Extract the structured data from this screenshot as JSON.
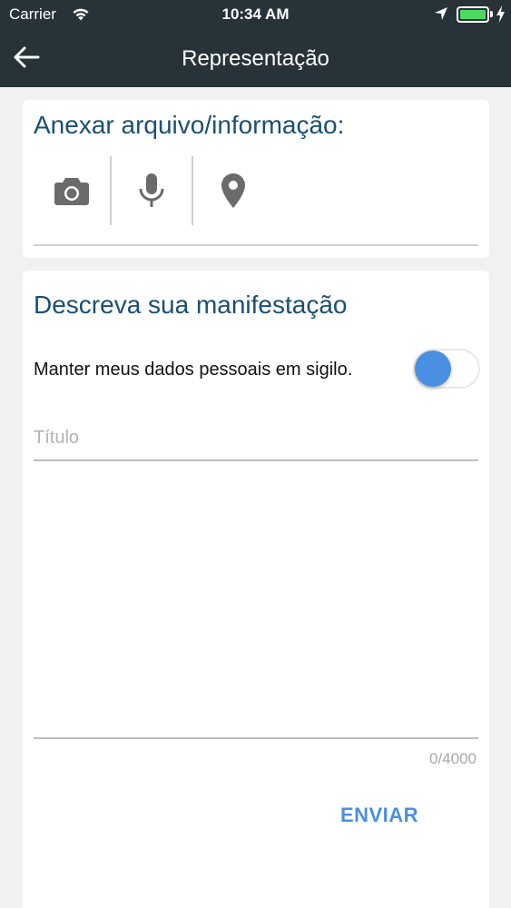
{
  "status_bar": {
    "carrier": "Carrier",
    "time": "10:34 AM",
    "battery_level": 1.0,
    "icons": [
      "wifi-icon",
      "location-arrow-icon",
      "battery-icon",
      "charging-bolt-icon"
    ]
  },
  "app_bar": {
    "title": "Representação",
    "back_icon": "arrow-left-icon"
  },
  "attach_section": {
    "heading": "Anexar arquivo/informação:",
    "buttons": [
      {
        "icon": "camera-icon"
      },
      {
        "icon": "microphone-icon"
      },
      {
        "icon": "map-pin-icon"
      }
    ]
  },
  "manifest_section": {
    "heading": "Descreva sua manifestação",
    "confidential_label": "Manter meus dados pessoais em sigilo.",
    "title_placeholder": "Título",
    "title_value": "",
    "description_value": "",
    "counter": "0/4000",
    "send_label": "ENVIAR"
  },
  "colors": {
    "header_bg": "#273239",
    "heading_text": "#1b4f72",
    "accent": "#4a90e2",
    "page_bg": "#f1f1f1",
    "battery_fill": "#4cd964"
  }
}
